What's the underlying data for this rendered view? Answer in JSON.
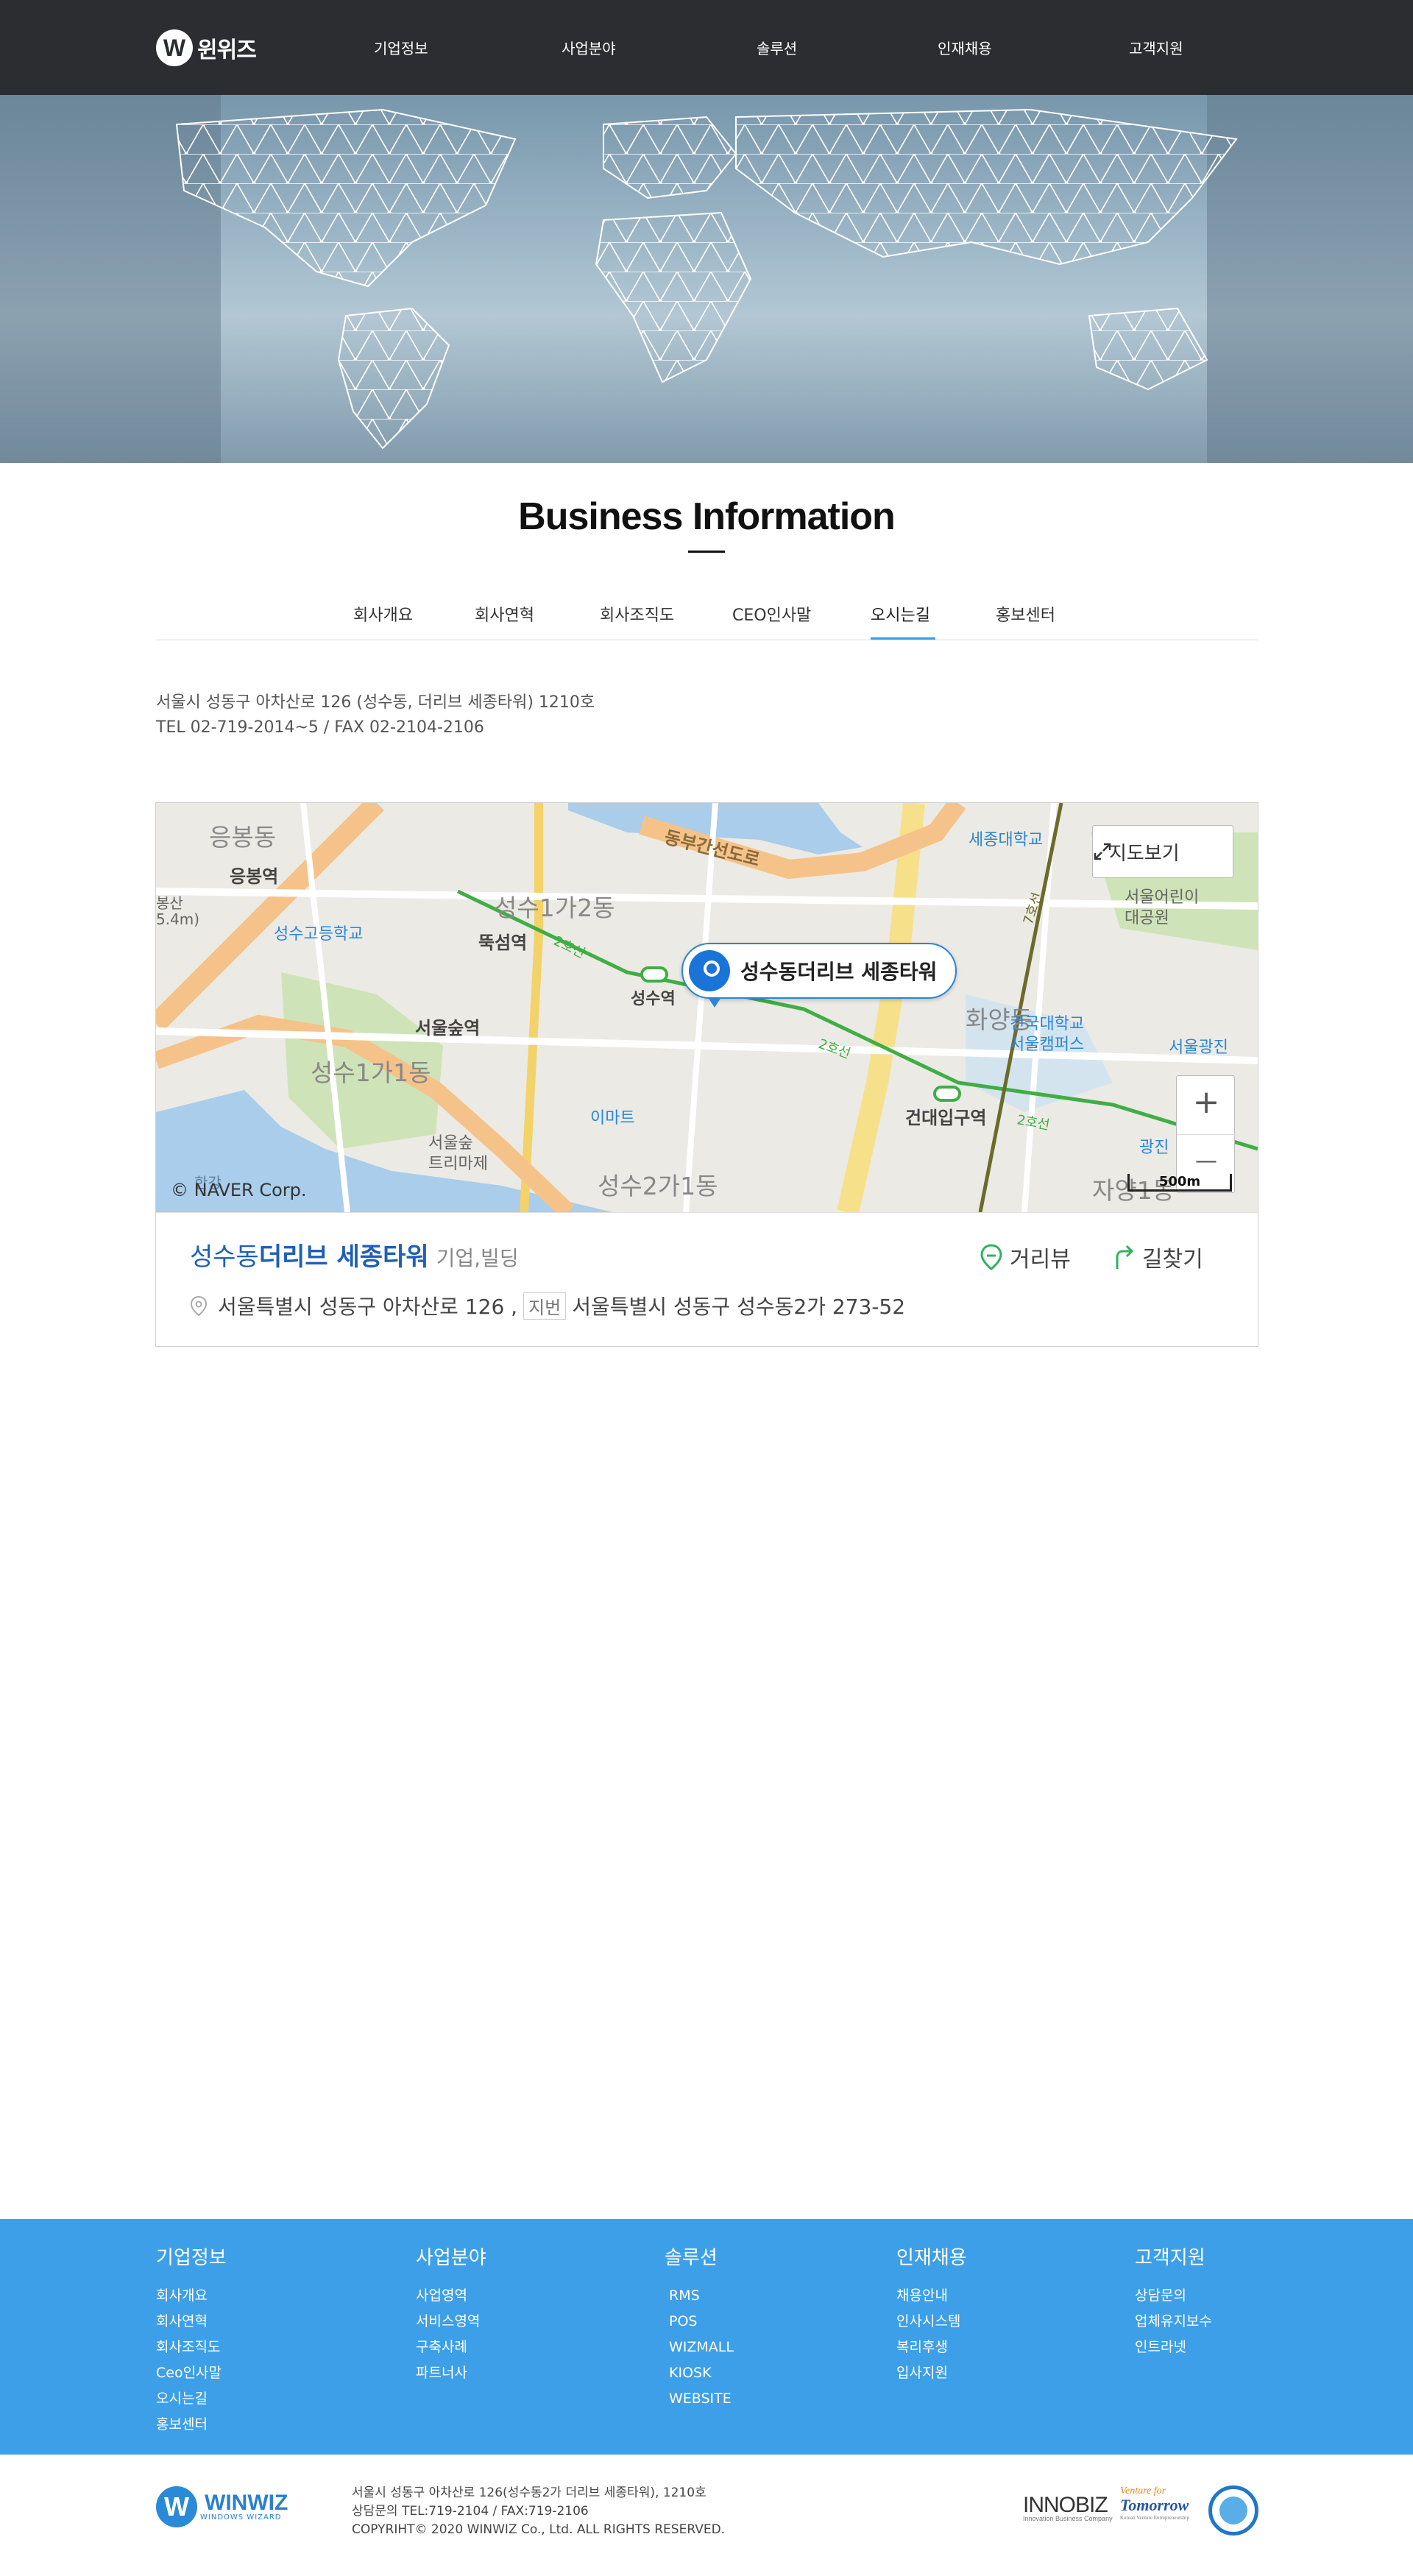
{
  "header": {
    "logo_letter": "W",
    "logo_text": "윈위즈",
    "nav": [
      "기업정보",
      "사업분야",
      "솔루션",
      "인재채용",
      "고객지원"
    ]
  },
  "page": {
    "title": "Business Information",
    "tabs": [
      "회사개요",
      "회사연혁",
      "회사조직도",
      "CEO인사말",
      "오시는길",
      "홍보센터"
    ],
    "active_tab": "오시는길",
    "address_line1": "서울시 성동구 아차산로 126 (성수동, 더리브 세종타워) 1210호",
    "address_line2": "TEL 02-719-2014~5 / FAX 02-2104-2106"
  },
  "map": {
    "view_button": "지도보기",
    "zoom_in": "+",
    "zoom_out": "—",
    "scale": "500m",
    "copyright": "© NAVER Corp.",
    "pin_label": "성수동더리브 세종타워",
    "labels": {
      "yongbong": "응봉동",
      "yongbong_st": "응봉역",
      "elev": "5.4m)",
      "seongsu_hs": "성수고등학교",
      "ttukseom": "뚝섬역",
      "seongsu_1ga2": "성수1가2동",
      "seongsu_st": "성수역",
      "seoulsup_st": "서울숲역",
      "seoulsup": "서울숲",
      "seongsu_1ga1": "성수1가1동",
      "emart": "이마트",
      "seoulsup_trimage": "서울숲",
      "trimage": "트리마제",
      "seongsu_2ga1": "성수2가1동",
      "hwayang": "화양동",
      "konkuk": "건국대학교",
      "seoul_campus": "서울캠퍼스",
      "konkuk_st": "건대입구역",
      "sejong_univ": "세종대학교",
      "childrens_park": "서울어린이",
      "grand_park": "대공원",
      "gwangjin": "서울광진",
      "gwangjin2": "광진",
      "jayang": "자양1동",
      "donbu": "동부간선도로",
      "line2_a": "2호선",
      "line2_b": "2호선",
      "line2_c": "2호선",
      "line7": "7호선",
      "hangang": "한강",
      "bunsan": "봉산"
    }
  },
  "place": {
    "name_prefix": "성수동",
    "name_main": "더리브 세종타워",
    "category": "기업,빌딩",
    "road_address": "서울특별시 성동구 아차산로 126 ,",
    "jibun_tag": "지번",
    "jibun_address": "서울특별시 성동구 성수동2가 273-52",
    "street_view": "거리뷰",
    "directions": "길찾기"
  },
  "footer_nav": [
    {
      "title": "기업정보",
      "items": [
        "회사개요",
        "회사연혁",
        "회사조직도",
        "Ceo인사말",
        "오시는길",
        "홍보센터"
      ]
    },
    {
      "title": "사업분야",
      "items": [
        "사업영역",
        "서비스영역",
        "구축사례",
        "파트너사"
      ]
    },
    {
      "title": "솔루션",
      "items": [
        "RMS",
        "POS",
        "WIZMALL",
        "KIOSK",
        "WEBSITE"
      ]
    },
    {
      "title": "인재채용",
      "items": [
        "채용안내",
        "인사시스템",
        "복리후생",
        "입사지원"
      ]
    },
    {
      "title": "고객지원",
      "items": [
        "상담문의",
        "업체유지보수",
        "인트라넷"
      ]
    }
  ],
  "footer": {
    "logo_letter": "W",
    "logo_text": "WINWIZ",
    "logo_sub": "WINDOWS WIZARD",
    "info_line1": "서울시 성동구 아차산로 126(성수동2가 더리브 세종타워), 1210호",
    "info_line2": "상담문의 TEL:719-2104 / FAX:719-2106",
    "info_line3": "COPYRIHT© 2020 WINWIZ Co., Ltd. ALL RIGHTS RESERVED.",
    "innobiz": "INNOBIZ",
    "innobiz_sub": "Innovation Business Company",
    "venture_top": "Venture for",
    "venture_main": "Tomorrow",
    "venture_sub": "Korean Venture Entrepreneurship"
  },
  "colors": {
    "header_bg": "#2c2d30",
    "accent": "#3d9fe7",
    "map_pin": "#1a74d8",
    "place_name": "#1f5fb8"
  }
}
